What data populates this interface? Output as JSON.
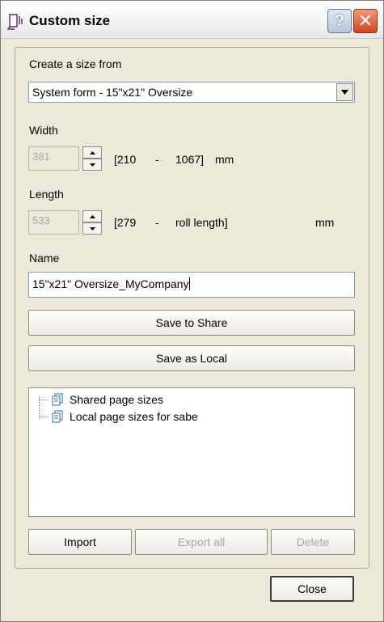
{
  "window": {
    "title": "Custom size"
  },
  "size_from": {
    "label": "Create a size from",
    "selected": "System form - 15\"x21\" Oversize"
  },
  "width": {
    "label": "Width",
    "value": "381",
    "range_min": "[210",
    "dash": "-",
    "range_max": "1067]",
    "unit": "mm"
  },
  "length": {
    "label": "Length",
    "value": "533",
    "range_min": "[279",
    "dash": "-",
    "range_max": "roll length]",
    "unit": "mm"
  },
  "name": {
    "label": "Name",
    "value": "15\"x21\" Oversize_MyCompany"
  },
  "buttons": {
    "save_share": "Save to Share",
    "save_local": "Save as Local",
    "import": "Import",
    "export_all": "Export all",
    "delete": "Delete",
    "close": "Close"
  },
  "tree": {
    "items": [
      "Shared page sizes",
      "Local page sizes for sabe"
    ]
  },
  "icons": {
    "help": "?",
    "close": "✕"
  }
}
